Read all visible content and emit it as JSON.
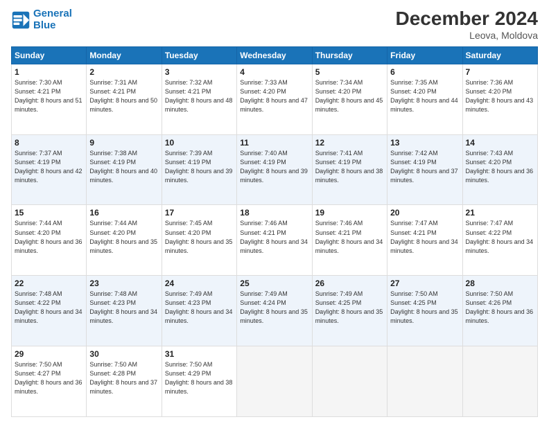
{
  "header": {
    "logo_line1": "General",
    "logo_line2": "Blue",
    "month_title": "December 2024",
    "location": "Leova, Moldova"
  },
  "weekdays": [
    "Sunday",
    "Monday",
    "Tuesday",
    "Wednesday",
    "Thursday",
    "Friday",
    "Saturday"
  ],
  "weeks": [
    [
      {
        "day": "1",
        "sunrise": "Sunrise: 7:30 AM",
        "sunset": "Sunset: 4:21 PM",
        "daylight": "Daylight: 8 hours and 51 minutes."
      },
      {
        "day": "2",
        "sunrise": "Sunrise: 7:31 AM",
        "sunset": "Sunset: 4:21 PM",
        "daylight": "Daylight: 8 hours and 50 minutes."
      },
      {
        "day": "3",
        "sunrise": "Sunrise: 7:32 AM",
        "sunset": "Sunset: 4:21 PM",
        "daylight": "Daylight: 8 hours and 48 minutes."
      },
      {
        "day": "4",
        "sunrise": "Sunrise: 7:33 AM",
        "sunset": "Sunset: 4:20 PM",
        "daylight": "Daylight: 8 hours and 47 minutes."
      },
      {
        "day": "5",
        "sunrise": "Sunrise: 7:34 AM",
        "sunset": "Sunset: 4:20 PM",
        "daylight": "Daylight: 8 hours and 45 minutes."
      },
      {
        "day": "6",
        "sunrise": "Sunrise: 7:35 AM",
        "sunset": "Sunset: 4:20 PM",
        "daylight": "Daylight: 8 hours and 44 minutes."
      },
      {
        "day": "7",
        "sunrise": "Sunrise: 7:36 AM",
        "sunset": "Sunset: 4:20 PM",
        "daylight": "Daylight: 8 hours and 43 minutes."
      }
    ],
    [
      {
        "day": "8",
        "sunrise": "Sunrise: 7:37 AM",
        "sunset": "Sunset: 4:19 PM",
        "daylight": "Daylight: 8 hours and 42 minutes."
      },
      {
        "day": "9",
        "sunrise": "Sunrise: 7:38 AM",
        "sunset": "Sunset: 4:19 PM",
        "daylight": "Daylight: 8 hours and 40 minutes."
      },
      {
        "day": "10",
        "sunrise": "Sunrise: 7:39 AM",
        "sunset": "Sunset: 4:19 PM",
        "daylight": "Daylight: 8 hours and 39 minutes."
      },
      {
        "day": "11",
        "sunrise": "Sunrise: 7:40 AM",
        "sunset": "Sunset: 4:19 PM",
        "daylight": "Daylight: 8 hours and 39 minutes."
      },
      {
        "day": "12",
        "sunrise": "Sunrise: 7:41 AM",
        "sunset": "Sunset: 4:19 PM",
        "daylight": "Daylight: 8 hours and 38 minutes."
      },
      {
        "day": "13",
        "sunrise": "Sunrise: 7:42 AM",
        "sunset": "Sunset: 4:19 PM",
        "daylight": "Daylight: 8 hours and 37 minutes."
      },
      {
        "day": "14",
        "sunrise": "Sunrise: 7:43 AM",
        "sunset": "Sunset: 4:20 PM",
        "daylight": "Daylight: 8 hours and 36 minutes."
      }
    ],
    [
      {
        "day": "15",
        "sunrise": "Sunrise: 7:44 AM",
        "sunset": "Sunset: 4:20 PM",
        "daylight": "Daylight: 8 hours and 36 minutes."
      },
      {
        "day": "16",
        "sunrise": "Sunrise: 7:44 AM",
        "sunset": "Sunset: 4:20 PM",
        "daylight": "Daylight: 8 hours and 35 minutes."
      },
      {
        "day": "17",
        "sunrise": "Sunrise: 7:45 AM",
        "sunset": "Sunset: 4:20 PM",
        "daylight": "Daylight: 8 hours and 35 minutes."
      },
      {
        "day": "18",
        "sunrise": "Sunrise: 7:46 AM",
        "sunset": "Sunset: 4:21 PM",
        "daylight": "Daylight: 8 hours and 34 minutes."
      },
      {
        "day": "19",
        "sunrise": "Sunrise: 7:46 AM",
        "sunset": "Sunset: 4:21 PM",
        "daylight": "Daylight: 8 hours and 34 minutes."
      },
      {
        "day": "20",
        "sunrise": "Sunrise: 7:47 AM",
        "sunset": "Sunset: 4:21 PM",
        "daylight": "Daylight: 8 hours and 34 minutes."
      },
      {
        "day": "21",
        "sunrise": "Sunrise: 7:47 AM",
        "sunset": "Sunset: 4:22 PM",
        "daylight": "Daylight: 8 hours and 34 minutes."
      }
    ],
    [
      {
        "day": "22",
        "sunrise": "Sunrise: 7:48 AM",
        "sunset": "Sunset: 4:22 PM",
        "daylight": "Daylight: 8 hours and 34 minutes."
      },
      {
        "day": "23",
        "sunrise": "Sunrise: 7:48 AM",
        "sunset": "Sunset: 4:23 PM",
        "daylight": "Daylight: 8 hours and 34 minutes."
      },
      {
        "day": "24",
        "sunrise": "Sunrise: 7:49 AM",
        "sunset": "Sunset: 4:23 PM",
        "daylight": "Daylight: 8 hours and 34 minutes."
      },
      {
        "day": "25",
        "sunrise": "Sunrise: 7:49 AM",
        "sunset": "Sunset: 4:24 PM",
        "daylight": "Daylight: 8 hours and 35 minutes."
      },
      {
        "day": "26",
        "sunrise": "Sunrise: 7:49 AM",
        "sunset": "Sunset: 4:25 PM",
        "daylight": "Daylight: 8 hours and 35 minutes."
      },
      {
        "day": "27",
        "sunrise": "Sunrise: 7:50 AM",
        "sunset": "Sunset: 4:25 PM",
        "daylight": "Daylight: 8 hours and 35 minutes."
      },
      {
        "day": "28",
        "sunrise": "Sunrise: 7:50 AM",
        "sunset": "Sunset: 4:26 PM",
        "daylight": "Daylight: 8 hours and 36 minutes."
      }
    ],
    [
      {
        "day": "29",
        "sunrise": "Sunrise: 7:50 AM",
        "sunset": "Sunset: 4:27 PM",
        "daylight": "Daylight: 8 hours and 36 minutes."
      },
      {
        "day": "30",
        "sunrise": "Sunrise: 7:50 AM",
        "sunset": "Sunset: 4:28 PM",
        "daylight": "Daylight: 8 hours and 37 minutes."
      },
      {
        "day": "31",
        "sunrise": "Sunrise: 7:50 AM",
        "sunset": "Sunset: 4:29 PM",
        "daylight": "Daylight: 8 hours and 38 minutes."
      },
      null,
      null,
      null,
      null
    ]
  ]
}
